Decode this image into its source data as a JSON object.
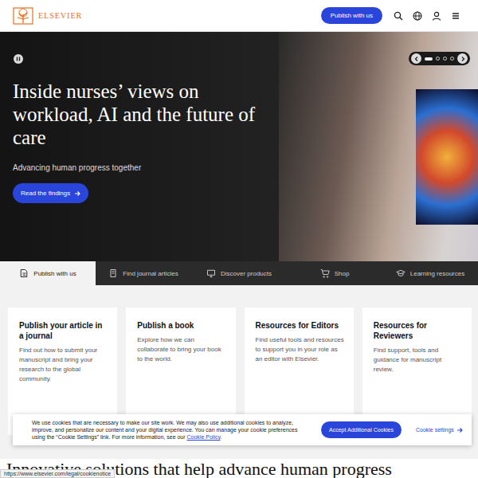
{
  "header": {
    "logo": "ELSEVIER",
    "cta": "Publish with us"
  },
  "hero": {
    "title": "Inside nurses’ views on workload, AI and the future of care",
    "subtitle": "Advancing human progress together",
    "button": "Read the findings",
    "slides": [
      {
        "selected": true
      },
      {
        "selected": false
      },
      {
        "selected": false
      },
      {
        "selected": false
      }
    ]
  },
  "tabs": [
    {
      "label": "Publish with us",
      "selected": true
    },
    {
      "label": "Find journal articles",
      "selected": false
    },
    {
      "label": "Discover products",
      "selected": false
    },
    {
      "label": "Shop",
      "selected": false
    },
    {
      "label": "Learning resources",
      "selected": false
    }
  ],
  "cards": [
    {
      "title": "Publish your article in a journal",
      "text": "Find out how to submit your manuscript and bring your research to the global community."
    },
    {
      "title": "Publish a book",
      "text": "Explore how we can collaborate to bring your book to the world."
    },
    {
      "title": "Resources for Editors",
      "text": "Find useful tools and resources to support you in your role as an editor with Elsevier."
    },
    {
      "title": "Resources for Reviewers",
      "text": "Find support, tools and guidance for manuscript review."
    }
  ],
  "section": {
    "heading": "Innovative solutions that help advance human progress"
  },
  "cookie_banner": {
    "text": "We use cookies that are necessary to make our site work. We may also use additional cookies to analyze, improve, and personalize our content and your digital experience. You can manage your cookie preferences using the “Cookie Settings” link. For more information, see our ",
    "link": "Cookie Policy",
    "text_after": ".",
    "accept": "Accept Additional Cookies",
    "settings": "Cookie settings"
  },
  "status_url": "https://www.elsevier.com/legal/cookienotice"
}
